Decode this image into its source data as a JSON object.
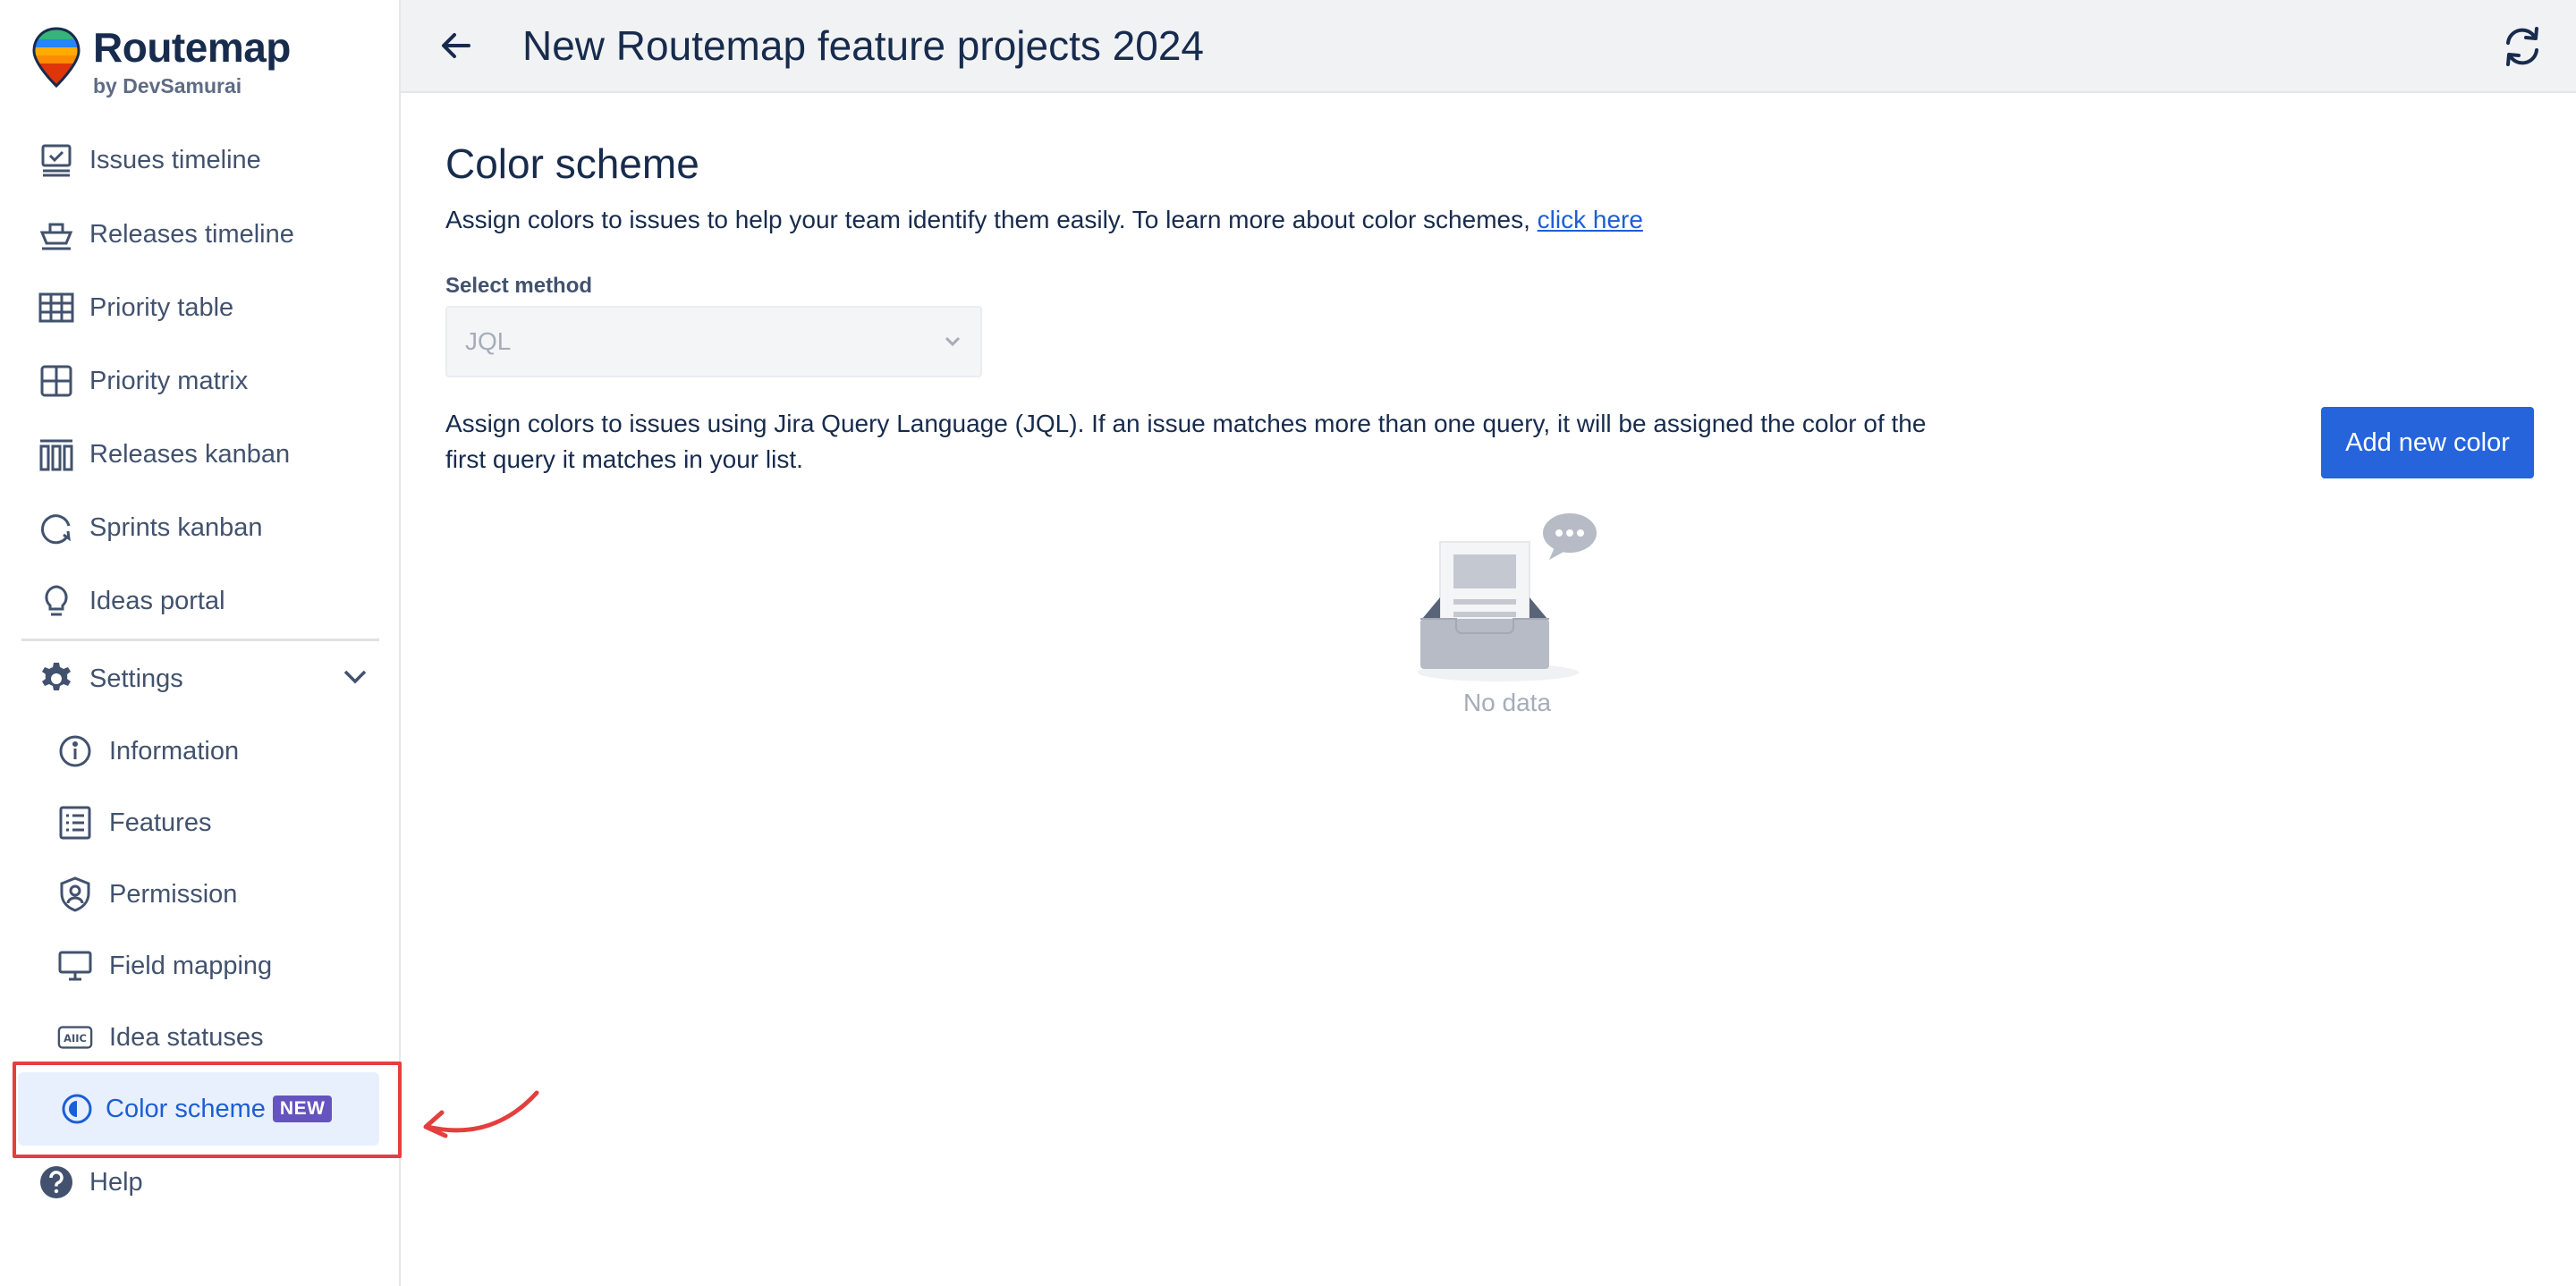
{
  "brand": {
    "name": "Routemap",
    "by": "by DevSamurai"
  },
  "nav": {
    "items": [
      {
        "label": "Issues timeline"
      },
      {
        "label": "Releases timeline"
      },
      {
        "label": "Priority table"
      },
      {
        "label": "Priority matrix"
      },
      {
        "label": "Releases kanban"
      },
      {
        "label": "Sprints kanban"
      },
      {
        "label": "Ideas portal"
      }
    ],
    "settings_label": "Settings",
    "settings_sub": [
      {
        "label": "Information"
      },
      {
        "label": "Features"
      },
      {
        "label": "Permission"
      },
      {
        "label": "Field mapping"
      },
      {
        "label": "Idea statuses"
      }
    ],
    "active": {
      "label": "Color scheme",
      "badge": "NEW"
    },
    "help_label": "Help"
  },
  "header": {
    "title": "New Routemap feature projects 2024"
  },
  "main": {
    "title": "Color scheme",
    "description": "Assign colors to issues to help your team identify them easily. To learn more about color schemes, ",
    "link_text": "click here",
    "select_label": "Select method",
    "select_value": "JQL",
    "jql_description": "Assign colors to issues using Jira Query Language (JQL). If an issue matches more than one query, it will be assigned the color of the first query it matches in your list.",
    "add_button": "Add new color",
    "empty_text": "No data"
  },
  "colors": {
    "accent": "#2664dc",
    "active_bg": "#e9f0fd",
    "badge": "#6554c0",
    "highlight": "#e53e3e"
  }
}
